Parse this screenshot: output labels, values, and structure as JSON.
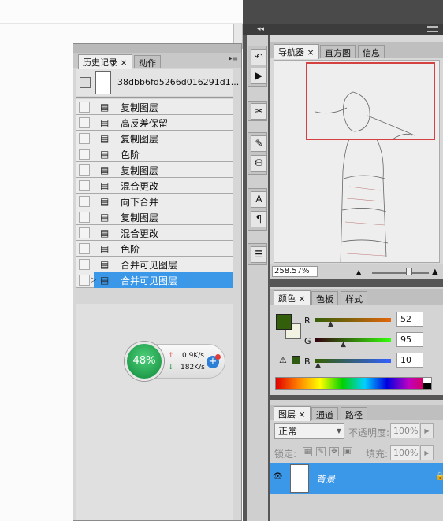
{
  "history_panel": {
    "tabs": [
      "历史记录",
      "动作"
    ],
    "snapshot_name": "38dbb6fd5266d016291d1...",
    "items": [
      "复制图层",
      "高反差保留",
      "复制图层",
      "色阶",
      "复制图层",
      "混合更改",
      "向下合并",
      "复制图层",
      "混合更改",
      "色阶",
      "合并可见图层",
      "合并可见图层"
    ],
    "selected_index": 11
  },
  "speed_widget": {
    "percent": "48%",
    "upload": "0.9K/s",
    "download": "182K/s"
  },
  "navigator_panel": {
    "tabs": [
      "导航器",
      "直方图",
      "信息"
    ],
    "zoom": "258.57%"
  },
  "color_panel": {
    "tabs": [
      "颜色",
      "色板",
      "样式"
    ],
    "channels": [
      {
        "label": "R",
        "value": "52"
      },
      {
        "label": "G",
        "value": "95"
      },
      {
        "label": "B",
        "value": "10"
      }
    ],
    "fg_color": "#345f0a",
    "bg_color": "#f2f2e2"
  },
  "layers_panel": {
    "tabs": [
      "图层",
      "通道",
      "路径"
    ],
    "blend_mode": "正常",
    "opacity_label": "不透明度:",
    "opacity": "100%",
    "lock_label": "锁定:",
    "fill_label": "填充:",
    "fill": "100%",
    "layer_name": "背景"
  },
  "icons": {
    "close": "close-icon",
    "panel_menu": "panel-menu-icon",
    "eye": "eye-icon",
    "lock": "lock-icon"
  }
}
